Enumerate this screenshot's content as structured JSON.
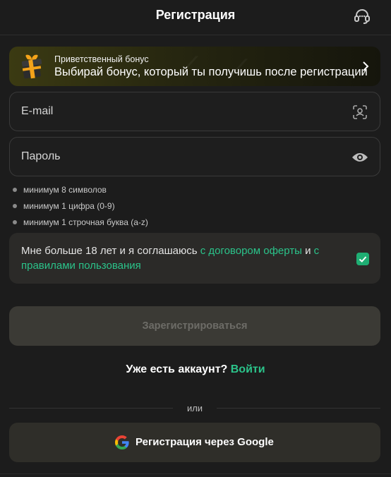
{
  "header": {
    "title": "Регистрация",
    "support_icon": "headset-icon"
  },
  "bonus": {
    "label": "Приветственный бонус",
    "text": "Выбирай бонус, который ты получишь после регистрации",
    "icon": "gift-icon",
    "accent": "#3b3a12"
  },
  "form": {
    "email_placeholder": "E-mail",
    "email_icon": "contact-scan-icon",
    "password_placeholder": "Пароль",
    "password_icon": "eye-icon"
  },
  "password_rules": [
    "минимум 8 символов",
    "минимум 1 цифра (0-9)",
    "минимум 1 строчная буква (a-z)"
  ],
  "consent": {
    "text_prefix": "Мне больше 18 лет и я соглашаюсь ",
    "link1": "с договором оферты",
    "middle": " и ",
    "link2": "с правилами пользования",
    "checked": true,
    "link_color": "#2bc38a"
  },
  "submit_label": "Зарегистрироваться",
  "login_prompt": {
    "question": "Уже есть аккаунт?",
    "link": "Войти"
  },
  "divider_text": "или",
  "google_button": "Регистрация через Google"
}
